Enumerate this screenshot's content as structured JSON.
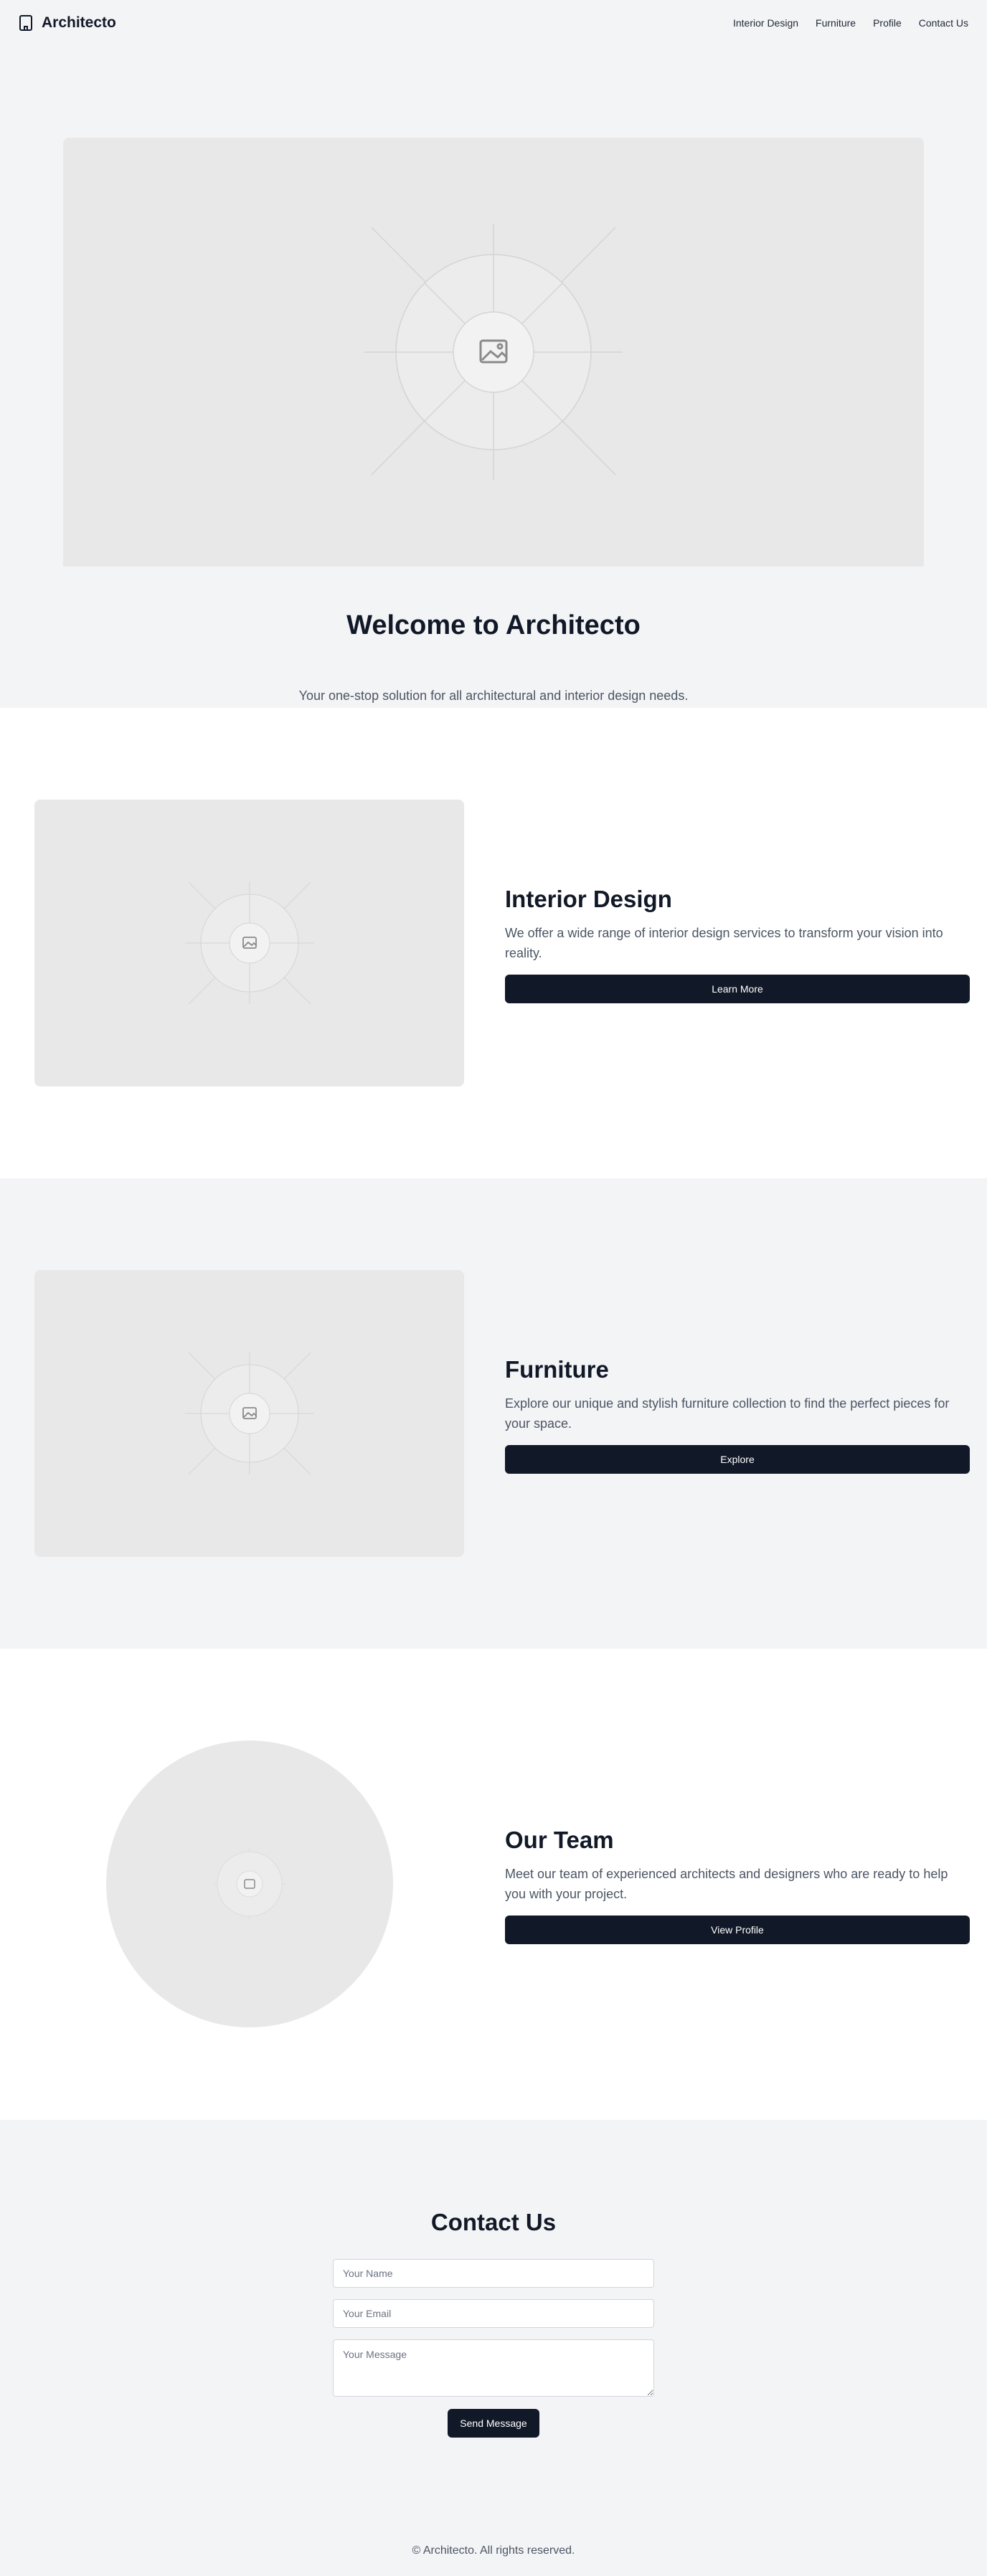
{
  "header": {
    "brand_name": "Architecto",
    "nav": [
      "Interior Design",
      "Furniture",
      "Profile",
      "Contact Us"
    ]
  },
  "hero": {
    "title": "Welcome to Architecto",
    "subtitle": "Your one-stop solution for all architectural and interior design needs."
  },
  "sections": [
    {
      "title": "Interior Design",
      "description": "We offer a wide range of interior design services to transform your vision into reality.",
      "button": "Learn More"
    },
    {
      "title": "Furniture",
      "description": "Explore our unique and stylish furniture collection to find the perfect pieces for your space.",
      "button": "Explore"
    },
    {
      "title": "Our Team",
      "description": "Meet our team of experienced architects and designers who are ready to help you with your project.",
      "button": "View Profile"
    }
  ],
  "contact": {
    "title": "Contact Us",
    "name_placeholder": "Your Name",
    "email_placeholder": "Your Email",
    "message_placeholder": "Your Message",
    "submit": "Send Message"
  },
  "footer": {
    "copyright": "© Architecto. All rights reserved."
  },
  "colors": {
    "primary": "#111827",
    "background_gray": "#f3f4f6",
    "placeholder_gray": "#e8e8e8",
    "body_text": "#4b5563"
  },
  "icons": {
    "brand": "building-icon",
    "placeholder": "image-icon"
  }
}
